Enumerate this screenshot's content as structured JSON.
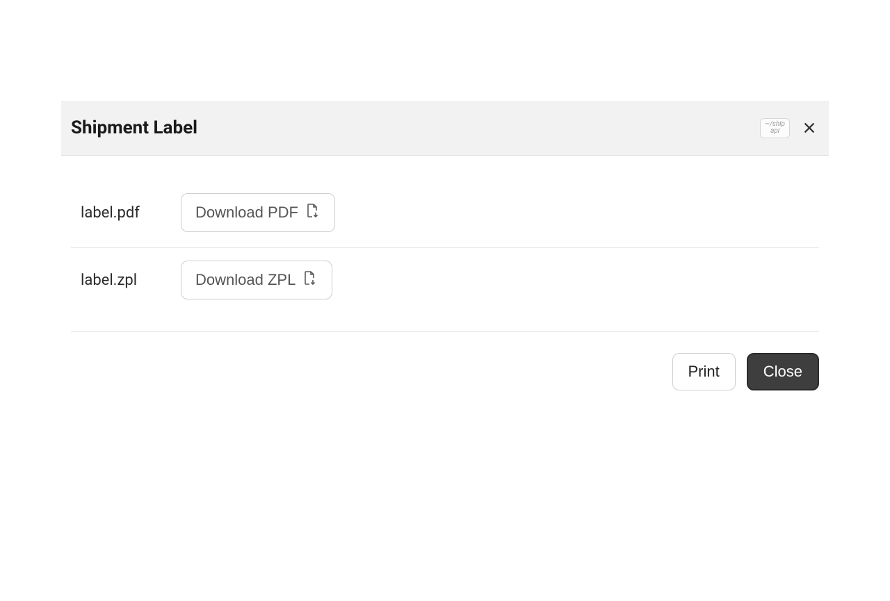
{
  "header": {
    "title": "Shipment Label",
    "badge_line1": "~/ship",
    "badge_line2": "api"
  },
  "files": [
    {
      "name": "label.pdf",
      "download_label": "Download PDF"
    },
    {
      "name": "label.zpl",
      "download_label": "Download ZPL"
    }
  ],
  "footer": {
    "print_label": "Print",
    "close_label": "Close"
  }
}
